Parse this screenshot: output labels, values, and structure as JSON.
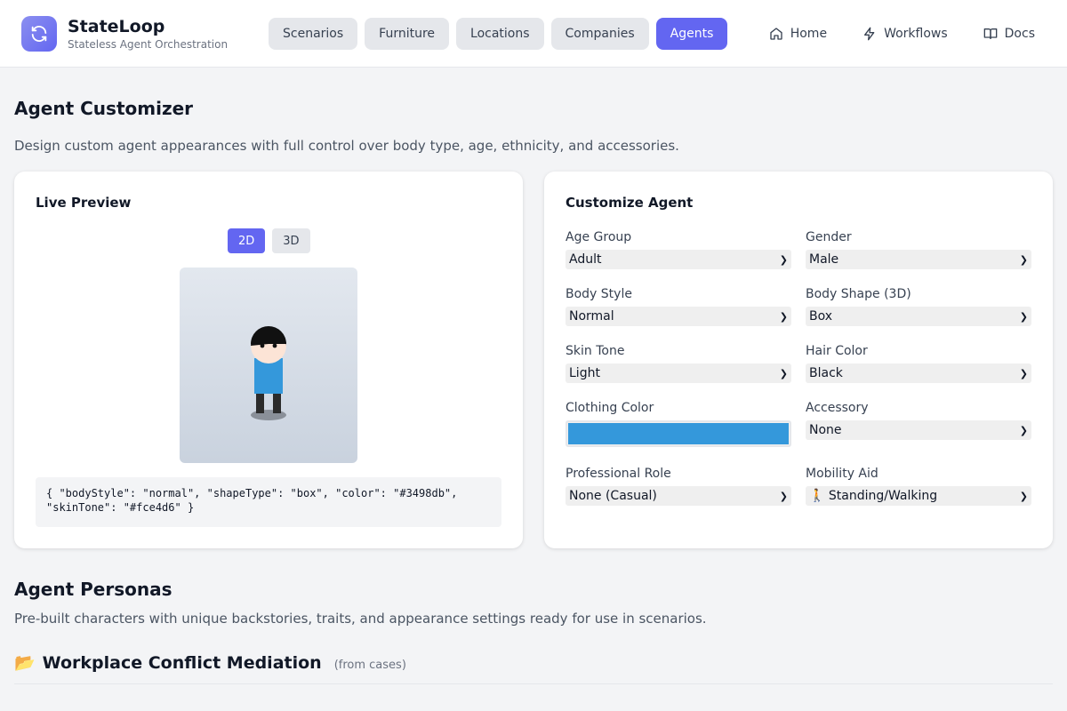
{
  "brand": {
    "title": "StateLoop",
    "subtitle": "Stateless Agent Orchestration"
  },
  "nav_tabs": [
    {
      "label": "Scenarios",
      "active": false
    },
    {
      "label": "Furniture",
      "active": false
    },
    {
      "label": "Locations",
      "active": false
    },
    {
      "label": "Companies",
      "active": false
    },
    {
      "label": "Agents",
      "active": true
    }
  ],
  "nav_links": [
    {
      "label": "Home",
      "icon": "home-icon"
    },
    {
      "label": "Workflows",
      "icon": "lightning-icon"
    },
    {
      "label": "Docs",
      "icon": "book-icon"
    }
  ],
  "page": {
    "title": "Agent Customizer",
    "description": "Design custom agent appearances with full control over body type, age, ethnicity, and accessories."
  },
  "preview": {
    "title": "Live Preview",
    "modes": [
      {
        "label": "2D",
        "active": true
      },
      {
        "label": "3D",
        "active": false
      }
    ],
    "json_line1": "{ \"bodyStyle\": \"normal\", \"shapeType\": \"box\", \"color\": \"#3498db\",",
    "json_line2": "\"skinTone\": \"#fce4d6\" }"
  },
  "customize": {
    "title": "Customize Agent",
    "fields": {
      "age_group": {
        "label": "Age Group",
        "value": "Adult"
      },
      "gender": {
        "label": "Gender",
        "value": "Male"
      },
      "body_style": {
        "label": "Body Style",
        "value": "Normal"
      },
      "body_shape": {
        "label": "Body Shape (3D)",
        "value": "Box"
      },
      "skin_tone": {
        "label": "Skin Tone",
        "value": "Light"
      },
      "hair_color": {
        "label": "Hair Color",
        "value": "Black"
      },
      "clothing_color": {
        "label": "Clothing Color",
        "value": "#3498db"
      },
      "accessory": {
        "label": "Accessory",
        "value": "None"
      },
      "professional_role": {
        "label": "Professional Role",
        "value": "None (Casual)"
      },
      "mobility_aid": {
        "label": "Mobility Aid",
        "value": "🚶 Standing/Walking"
      }
    }
  },
  "personas": {
    "title": "Agent Personas",
    "description": "Pre-built characters with unique backstories, traits, and appearance settings ready for use in scenarios.",
    "group_icon": "📂",
    "group_title": "Workplace Conflict Mediation",
    "group_source": "(from cases)"
  },
  "colors": {
    "accent": "#6366f1",
    "clothing": "#3498db",
    "skin": "#fce4d6",
    "hair": "#111111"
  }
}
